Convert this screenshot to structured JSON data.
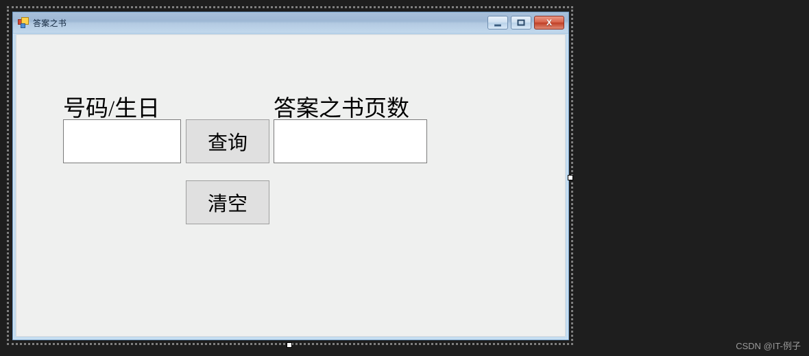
{
  "window": {
    "title": "答案之书",
    "icon": "winforms-app-icon",
    "controls": {
      "minimize_label": "",
      "maximize_label": "",
      "close_label": "X"
    }
  },
  "form": {
    "labels": {
      "number_birthday": "号码/生日",
      "answer_page": "答案之书页数"
    },
    "textboxes": {
      "number_birthday_value": "",
      "answer_page_value": ""
    },
    "buttons": {
      "query": "查询",
      "clear": "清空"
    }
  },
  "designer": {
    "canvas_background": "#1e1e1e",
    "form_frame_color": "#c3dcf0",
    "form_client_background": "#eff0ef",
    "selection_border_color": "#808080"
  },
  "watermark": {
    "text": "CSDN @IT-例子"
  }
}
